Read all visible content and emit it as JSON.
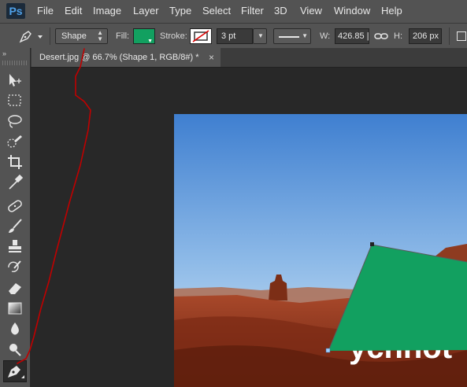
{
  "app": {
    "logo": "Ps"
  },
  "menu": [
    "File",
    "Edit",
    "Image",
    "Layer",
    "Type",
    "Select",
    "Filter",
    "3D",
    "View",
    "Window",
    "Help"
  ],
  "options": {
    "mode": "Shape",
    "fill_label": "Fill:",
    "fill_color": "#12a060",
    "stroke_label": "Stroke:",
    "stroke_width": "3 pt",
    "w_label": "W:",
    "w_value": "426.85 |",
    "h_label": "H:",
    "h_value": "206 px"
  },
  "document": {
    "tab_title": "Desert.jpg @ 66.7% (Shape 1, RGB/8#) *",
    "close": "×"
  },
  "image": {
    "overlay_text": "ychhot"
  },
  "colors": {
    "panel": "#535353",
    "canvas_bg": "#282828",
    "shape_fill": "#12a060",
    "annotation": "#c00000"
  },
  "tools": [
    "move-tool",
    "marquee-tool",
    "lasso-tool",
    "quick-selection-tool",
    "crop-tool",
    "eyedropper-tool",
    "healing-brush-tool",
    "brush-tool",
    "clone-stamp-tool",
    "history-brush-tool",
    "eraser-tool",
    "gradient-tool",
    "blur-tool",
    "dodge-tool",
    "pen-tool"
  ],
  "active_tool": "pen-tool"
}
